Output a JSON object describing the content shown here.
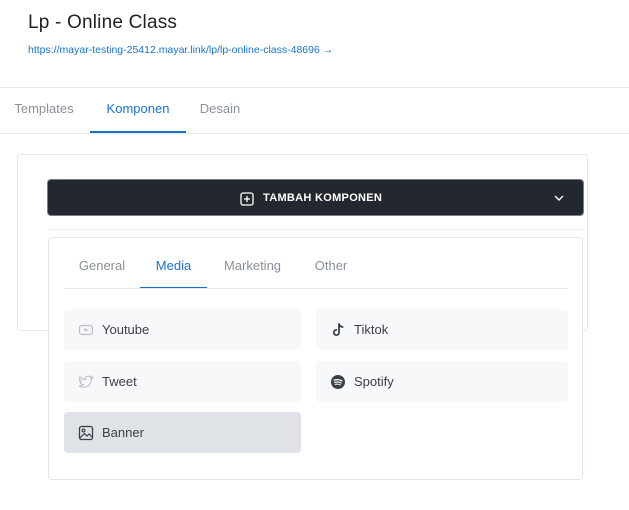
{
  "header": {
    "title": "Lp - Online Class",
    "link": "https://mayar-testing-25412.mayar.link/lp/lp-online-class-48696 →"
  },
  "tabs": [
    {
      "label": "Templates",
      "active": false
    },
    {
      "label": "Komponen",
      "active": true
    },
    {
      "label": "Desain",
      "active": false
    }
  ],
  "add_component": {
    "label": "TAMBAH KOMPONEN"
  },
  "component_tabs": [
    {
      "label": "General",
      "active": false
    },
    {
      "label": "Media",
      "active": true
    },
    {
      "label": "Marketing",
      "active": false
    },
    {
      "label": "Other",
      "active": false
    }
  ],
  "media_items": [
    {
      "label": "Youtube",
      "icon": "youtube-icon",
      "selected": false
    },
    {
      "label": "Tiktok",
      "icon": "tiktok-icon",
      "selected": false
    },
    {
      "label": "Tweet",
      "icon": "twitter-icon",
      "selected": false
    },
    {
      "label": "Spotify",
      "icon": "spotify-icon",
      "selected": false
    },
    {
      "label": "Banner",
      "icon": "image-icon",
      "selected": true
    }
  ],
  "colors": {
    "accent": "#1a73c8",
    "button_bg": "#23272e",
    "item_bg": "#f7f8fa",
    "item_selected_bg": "#dfe2e7"
  }
}
